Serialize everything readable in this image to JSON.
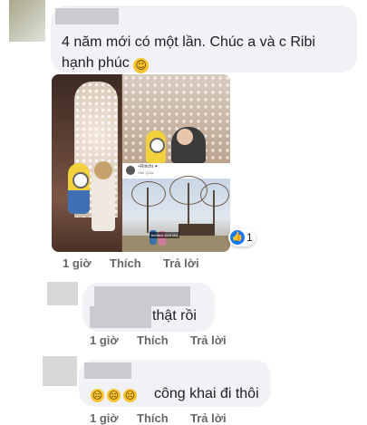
{
  "comments": [
    {
      "text": "4 năm mới có một lần. Chúc a và c Ribi hạnh phúc",
      "emoji": "smile",
      "reaction": {
        "icon": "thumbs-up-icon",
        "count": "1"
      },
      "photo_post": {
        "author": "+Ririchi ✦",
        "place": "Hàn Quốc",
        "tag": "behave   dont shy"
      },
      "actions": {
        "time": "1 giờ",
        "like": "Thích",
        "reply": "Trả lời"
      }
    },
    {
      "text": "thật rồi",
      "actions": {
        "time": "1 giờ",
        "like": "Thích",
        "reply": "Trả lời"
      }
    },
    {
      "text": "công khai đi thôi",
      "emoji": "sad-x3",
      "actions": {
        "time": "1 giờ",
        "like": "Thích",
        "reply": "Trả lời"
      }
    }
  ],
  "colors": {
    "bubble": "#f0f2f5",
    "like_blue": "#1877f2",
    "meta_gray": "#65676b"
  }
}
